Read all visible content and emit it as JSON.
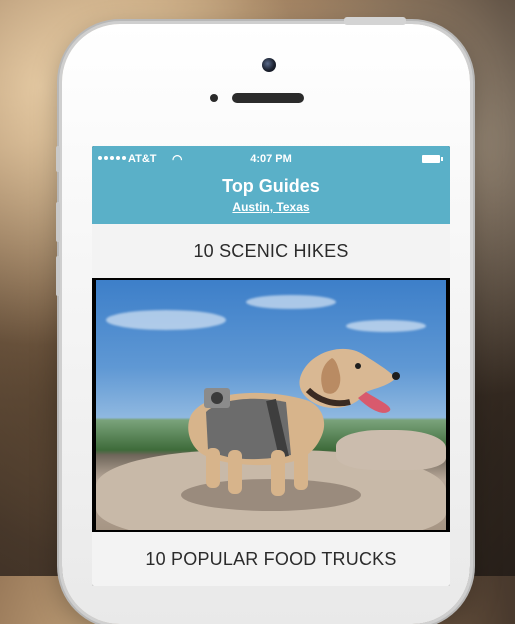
{
  "status_bar": {
    "carrier": "AT&T",
    "time": "4:07 PM"
  },
  "nav": {
    "title": "Top Guides",
    "subtitle": "Austin, Texas"
  },
  "guides": [
    {
      "title": "10 SCENIC HIKES"
    },
    {
      "title": "10 POPULAR FOOD TRUCKS"
    }
  ],
  "icons": {
    "wifi": "wifi-icon",
    "battery": "battery-icon",
    "signal": "signal-icon"
  },
  "colors": {
    "nav_bg": "#5ab0c8",
    "card_bg": "#f3f3f3",
    "text_dark": "#2b2b2b"
  }
}
